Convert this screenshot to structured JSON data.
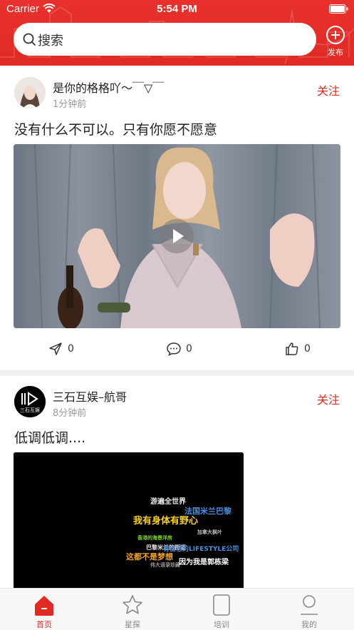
{
  "status_bar": {
    "carrier": "Carrier",
    "time": "5:54 PM"
  },
  "header": {
    "search_placeholder": "搜索",
    "publish_label": "发布",
    "accent_color": "#e02a24"
  },
  "feed": [
    {
      "author": "是你的格格吖～￣▽￣",
      "time": "1分钟前",
      "follow_label": "关注",
      "text": "没有什么不可以。只有你愿不愿意",
      "media": "video",
      "actions": {
        "shares": "0",
        "comments": "0",
        "likes": "0"
      }
    },
    {
      "author": "三石互娱–航哥",
      "avatar_text": "三石互娱",
      "time": "8分钟前",
      "follow_label": "关注",
      "text": "低调低调....",
      "media": "video",
      "word_cloud": [
        "游遍全世界",
        "法国米兰巴黎",
        "我有身体有野心",
        "这都不是梦想",
        "有自己的LIFESTYLE公司",
        "因为我是郭栋梁",
        "香港的海景洋房",
        "巴黎米兰的街道",
        "加拿大枫叶",
        "伟大语录珍藏"
      ]
    }
  ],
  "tabbar": {
    "items": [
      {
        "label": "首页",
        "icon": "home-icon",
        "active": true
      },
      {
        "label": "星探",
        "icon": "star-icon",
        "active": false
      },
      {
        "label": "培训",
        "icon": "training-icon",
        "active": false
      },
      {
        "label": "我的",
        "icon": "profile-icon",
        "active": false
      }
    ]
  }
}
